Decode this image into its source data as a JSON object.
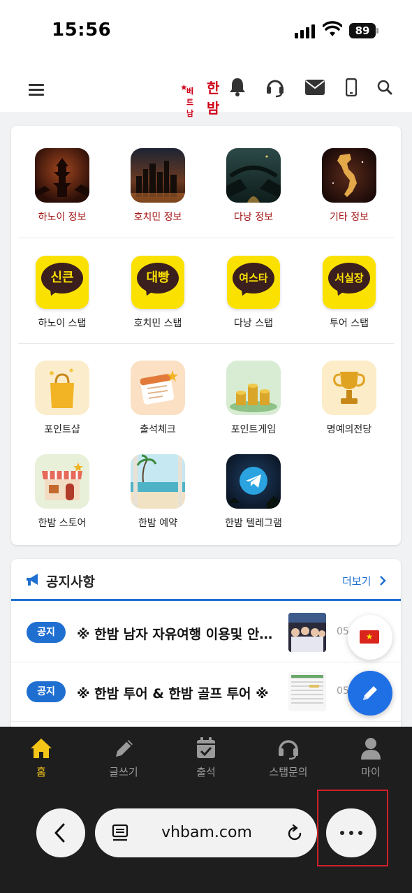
{
  "status_bar": {
    "time": "15:56",
    "battery": "89"
  },
  "header": {
    "logo_small": "베트남",
    "logo_main": "한밤",
    "icons": [
      "menu-icon",
      "bell-icon",
      "headset-icon",
      "mail-icon",
      "phone-icon",
      "search-icon"
    ]
  },
  "menu": {
    "cities": [
      {
        "label": "하노이 정보",
        "icon": "hanoi-pagoda-icon"
      },
      {
        "label": "호치민 정보",
        "icon": "hochiminh-skyline-icon"
      },
      {
        "label": "다낭 정보",
        "icon": "danang-bridge-icon"
      },
      {
        "label": "기타 정보",
        "icon": "vietnam-map-icon"
      }
    ],
    "staff": [
      {
        "label": "하노이 스탭",
        "bubble": "신큰"
      },
      {
        "label": "호치민 스탭",
        "bubble": "대빵"
      },
      {
        "label": "다낭 스탭",
        "bubble": "여스타"
      },
      {
        "label": "투어 스탭",
        "bubble": "서실장"
      }
    ],
    "points": [
      {
        "label": "포인트샵",
        "icon": "shopping-bag-icon"
      },
      {
        "label": "출석체크",
        "icon": "calendar-icon"
      },
      {
        "label": "포인트게임",
        "icon": "coins-icon"
      },
      {
        "label": "명예의전당",
        "icon": "trophy-icon"
      }
    ],
    "more": [
      {
        "label": "한밤 스토어",
        "icon": "store-icon"
      },
      {
        "label": "한밤 예약",
        "icon": "beach-resort-icon"
      },
      {
        "label": "한밤 텔레그램",
        "icon": "telegram-icon"
      }
    ]
  },
  "notice": {
    "title": "공지사항",
    "more_label": "더보기",
    "items": [
      {
        "badge": "공지",
        "text": "※ 한밤 남자 자유여행 이용및 안…",
        "date": "05"
      },
      {
        "badge": "공지",
        "text": "※ 한밤 투어 & 한밤 골프 투어 ※",
        "date": "05"
      }
    ]
  },
  "fab": {
    "flag_icon": "vietnam-flag-icon",
    "edit_icon": "pencil-icon"
  },
  "bottom_nav": [
    {
      "label": "홈",
      "icon": "home-icon",
      "active": true
    },
    {
      "label": "글쓰기",
      "icon": "pencil-icon",
      "active": false
    },
    {
      "label": "출석",
      "icon": "calendar-check-icon",
      "active": false
    },
    {
      "label": "스탭문의",
      "icon": "headset-icon",
      "active": false
    },
    {
      "label": "마이",
      "icon": "user-icon",
      "active": false
    }
  ],
  "browser": {
    "url": "vhbam.com"
  },
  "colors": {
    "accent_blue": "#1f6fd1",
    "nav_active": "#f5c518",
    "kakao_yellow": "#fae100",
    "brand_red": "#d0021b",
    "highlight_red": "#d0202a"
  }
}
